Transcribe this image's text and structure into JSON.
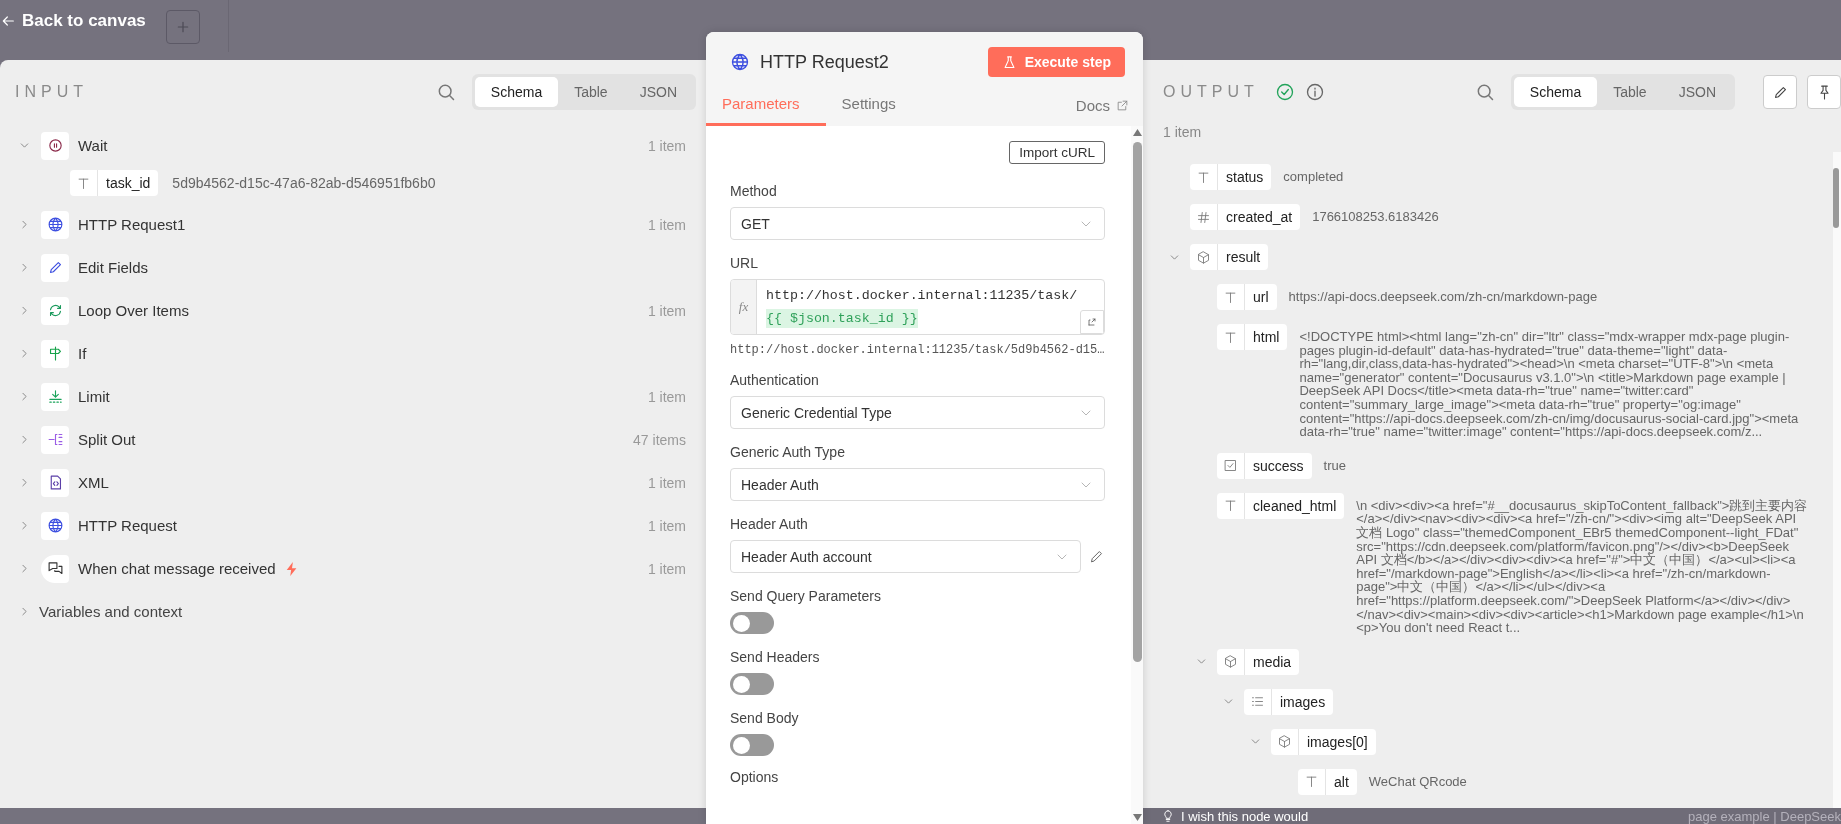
{
  "top_bar": {
    "back_label": "Back to canvas"
  },
  "input": {
    "title": "INPUT",
    "view_tabs": [
      {
        "label": "Schema",
        "selected": true
      },
      {
        "label": "Table",
        "selected": false
      },
      {
        "label": "JSON",
        "selected": false
      }
    ],
    "nodes": [
      {
        "kind": "wait",
        "name": "Wait",
        "count": "1 item",
        "expanded": true,
        "fields": [
          {
            "kind": "string",
            "key": "task_id",
            "value": "5d9b4562-d15c-47a6-82ab-d546951fb6b0"
          }
        ]
      },
      {
        "kind": "http",
        "name": "HTTP Request1",
        "count": "1 item",
        "expanded": false
      },
      {
        "kind": "edit",
        "name": "Edit Fields",
        "expanded": false
      },
      {
        "kind": "loop",
        "name": "Loop Over Items",
        "count": "1 item",
        "expanded": false
      },
      {
        "kind": "if",
        "name": "If",
        "expanded": false
      },
      {
        "kind": "limit",
        "name": "Limit",
        "count": "1 item",
        "expanded": false
      },
      {
        "kind": "split",
        "name": "Split Out",
        "count": "47 items",
        "expanded": false
      },
      {
        "kind": "xml",
        "name": "XML",
        "count": "1 item",
        "expanded": false
      },
      {
        "kind": "http",
        "name": "HTTP Request",
        "count": "1 item",
        "expanded": false
      },
      {
        "kind": "chat",
        "name": "When chat message received",
        "count": "1 item",
        "expanded": false,
        "trigger": true
      }
    ],
    "context": {
      "label": "Variables and context",
      "expanded": false
    }
  },
  "parameters": {
    "title": "HTTP Request2",
    "execute_label": "Execute step",
    "tabs": [
      {
        "label": "Parameters",
        "selected": true
      },
      {
        "label": "Settings",
        "selected": false
      }
    ],
    "docs_label": "Docs",
    "import_label": "Import cURL",
    "fields": [
      {
        "kind": "select",
        "label": "Method",
        "value": "GET"
      },
      {
        "kind": "expression",
        "label": "URL",
        "gutter": "fx",
        "text": "http://host.docker.internal:11235/task/",
        "expression": "{{ $json.task_id }}",
        "preview": "http://host.docker.internal:11235/task/5d9b4562-d15…"
      },
      {
        "kind": "select",
        "label": "Authentication",
        "value": "Generic Credential Type"
      },
      {
        "kind": "select",
        "label": "Generic Auth Type",
        "value": "Header Auth"
      },
      {
        "kind": "select",
        "label": "Header Auth",
        "value": "Header Auth account",
        "editable": true
      },
      {
        "kind": "toggle",
        "label": "Send Query Parameters",
        "on": false
      },
      {
        "kind": "toggle",
        "label": "Send Headers",
        "on": false
      },
      {
        "kind": "toggle",
        "label": "Send Body",
        "on": false
      },
      {
        "kind": "heading",
        "label": "Options"
      }
    ]
  },
  "output": {
    "title": "OUTPUT",
    "executed": true,
    "view_tabs": [
      {
        "label": "Schema",
        "selected": true
      },
      {
        "label": "Table",
        "selected": false
      },
      {
        "label": "JSON",
        "selected": false
      }
    ],
    "item_count": "1 item",
    "tree": [
      {
        "kind": "string",
        "key": "status",
        "value": "completed"
      },
      {
        "kind": "number",
        "key": "created_at",
        "value": "1766108253.6183426"
      },
      {
        "kind": "object",
        "key": "result",
        "expanded": true,
        "children": [
          {
            "kind": "string",
            "key": "url",
            "value": "https://api-docs.deepseek.com/zh-cn/markdown-page"
          },
          {
            "kind": "string",
            "key": "html",
            "value": "<!DOCTYPE html><html lang=\"zh-cn\" dir=\"ltr\" class=\"mdx-wrapper mdx-page plugin-pages plugin-id-default\" data-has-hydrated=\"true\" data-theme=\"light\" data-rh=\"lang,dir,class,data-has-hydrated\"><head>\\n <meta charset=\"UTF-8\">\\n <meta name=\"generator\" content=\"Docusaurus v3.1.0\">\\n <title>Markdown page example | DeepSeek API Docs</title><meta data-rh=\"true\" name=\"twitter:card\" content=\"summary_large_image\"><meta data-rh=\"true\" property=\"og:image\" content=\"https://api-docs.deepseek.com/zh-cn/img/docusaurus-social-card.jpg\"><meta data-rh=\"true\" name=\"twitter:image\" content=\"https://api-docs.deepseek.com/z..."
          },
          {
            "kind": "boolean",
            "key": "success",
            "value": "true"
          },
          {
            "kind": "string",
            "key": "cleaned_html",
            "value": "\\n <div><div><a href=\"#__docusaurus_skipToContent_fallback\">跳到主要内容</a></div><nav><div><div><a href=\"/zh-cn/\"><div><img alt=\"DeepSeek API 文档 Logo\" class=\"themedComponent_EBr5 themedComponent--light_FDat\" src=\"https://cdn.deepseek.com/platform/favicon.png\"/></div><b>DeepSeek API 文档</b></a></div><div><div><a href=\"#\">中文（中国）</a><ul><li><a href=\"/markdown-page\">English</a></li><li><a href=\"/zh-cn/markdown-page\">中文（中国）</a></li></ul></div><a href=\"https://platform.deepseek.com/\">DeepSeek Platform</a></div></div></nav><div><main><div><div><article><h1>Markdown page example</h1>\\n <p>You don't need React t..."
          },
          {
            "kind": "object",
            "key": "media",
            "expanded": true,
            "children": [
              {
                "kind": "array",
                "key": "images",
                "expanded": true,
                "children": [
                  {
                    "kind": "object",
                    "key": "images[0]",
                    "expanded": true,
                    "children": [
                      {
                        "kind": "string",
                        "key": "alt",
                        "value": "WeChat QRcode"
                      }
                    ]
                  }
                ]
              }
            ]
          }
        ]
      }
    ]
  },
  "footer": {
    "feedback": "I wish this node would",
    "trailing": "page example | DeepSeek"
  }
}
